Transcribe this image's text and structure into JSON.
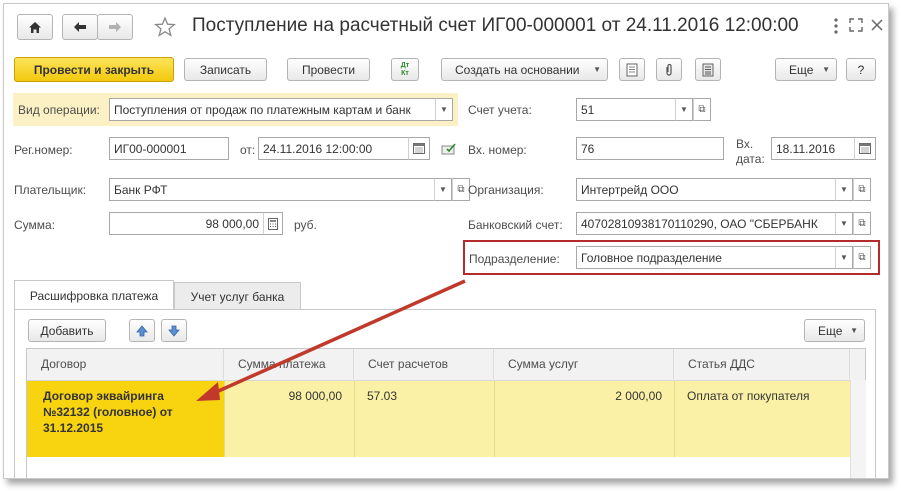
{
  "window": {
    "title": "Поступление на расчетный счет ИГ00-000001 от 24.11.2016 12:00:00"
  },
  "nav": {
    "home_icon": "home-icon",
    "back_icon": "arrow-left-icon",
    "forward_icon": "arrow-right-icon",
    "favorite_icon": "star-icon",
    "more_icon": "kebab-menu-icon",
    "maximize_icon": "expand-icon",
    "close_icon": "close-icon"
  },
  "toolbar": {
    "post_close_label": "Провести и закрыть",
    "save_label": "Записать",
    "post_label": "Провести",
    "dtkt_label": "Дт Кт",
    "create_based_label": "Создать на основании",
    "more_label": "Еще",
    "help_label": "?"
  },
  "form": {
    "operation_type_label": "Вид операции:",
    "operation_type_value": "Поступления от продаж по платежным картам и банк",
    "account_label": "Счет учета:",
    "account_value": "51",
    "reg_number_label": "Рег.номер:",
    "reg_number_value": "ИГ00-000001",
    "from_label": "от:",
    "from_value": "24.11.2016 12:00:00",
    "incoming_number_label": "Вх. номер:",
    "incoming_number_value": "76",
    "incoming_date_label_1": "Вх.",
    "incoming_date_label_2": "дата:",
    "incoming_date_value": "18.11.2016",
    "payer_label": "Плательщик:",
    "payer_value": "Банк РФТ",
    "organization_label": "Организация:",
    "organization_value": "Интертрейд ООО",
    "amount_label": "Сумма:",
    "amount_value": "98 000,00",
    "currency_label": "руб.",
    "bank_account_label": "Банковский счет:",
    "bank_account_value": "40702810938170110290, ОАО \"СБЕРБАНК",
    "department_label": "Подразделение:",
    "department_value": "Головное подразделение"
  },
  "tabs": [
    {
      "label": "Расшифровка платежа",
      "active": true
    },
    {
      "label": "Учет услуг банка",
      "active": false
    }
  ],
  "table_toolbar": {
    "add_label": "Добавить",
    "more_label": "Еще"
  },
  "table": {
    "columns": [
      "Договор",
      "Сумма платежа",
      "Счет расчетов",
      "Сумма услуг",
      "Статья ДДС"
    ],
    "rows": [
      {
        "contract": "Договор эквайринга №32132 (головное) от 31.12.2015",
        "payment_amount": "98 000,00",
        "settlement_account": "57.03",
        "service_amount": "2 000,00",
        "cash_flow_item": "Оплата от покупателя"
      }
    ]
  },
  "colors": {
    "highlight_box": "#b52a2a",
    "arrow": "#c0392b",
    "primary_button": "#f7d117",
    "selected_row": "#fbf1a6",
    "selected_cell": "#f7d40f"
  }
}
